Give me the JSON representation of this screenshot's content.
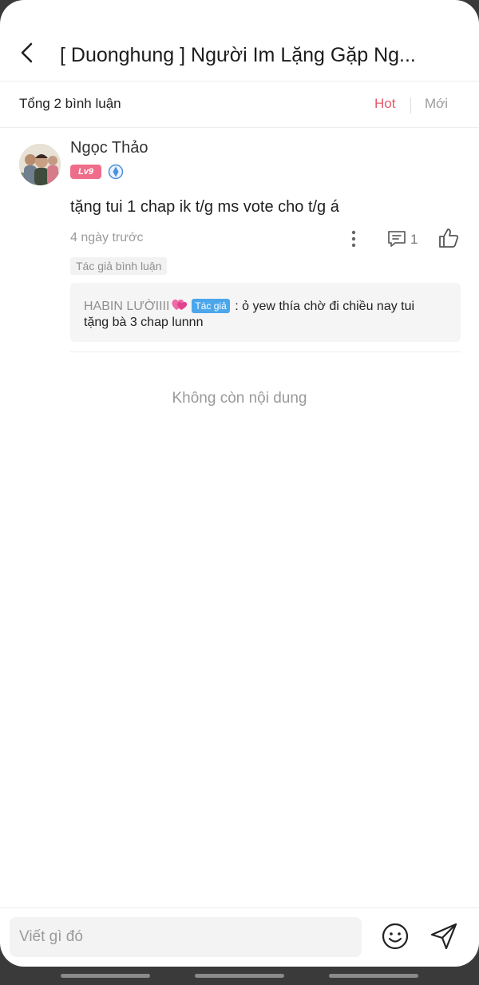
{
  "header": {
    "title": "[ Duonghung ] Người Im Lặng Gặp Ng..."
  },
  "subbar": {
    "total": "Tổng 2 bình luận",
    "sort_hot": "Hot",
    "sort_new": "Mới"
  },
  "comment": {
    "username": "Ngọc Thảo",
    "level": "Lv9",
    "text": "tặng tui 1 chap ik t/g ms vote cho t/g á",
    "time": "4 ngày trước",
    "reply_count": "1",
    "author_tag": "Tác giả bình luận",
    "reply": {
      "name": "HABIN LƯỜIIII",
      "badge": "Tác giả",
      "separator": " : ",
      "text_line1": "ỏ yew thía chờ đi chiều nay tui",
      "text_line2": "tặng bà 3 chap lunnn"
    }
  },
  "footer": {
    "no_more": "Không còn nội dung",
    "input_placeholder": "Viết gì đó"
  },
  "colors": {
    "accent": "#e5596a",
    "level_badge": "#ef6d8a",
    "author_badge": "#4ba6ec"
  }
}
